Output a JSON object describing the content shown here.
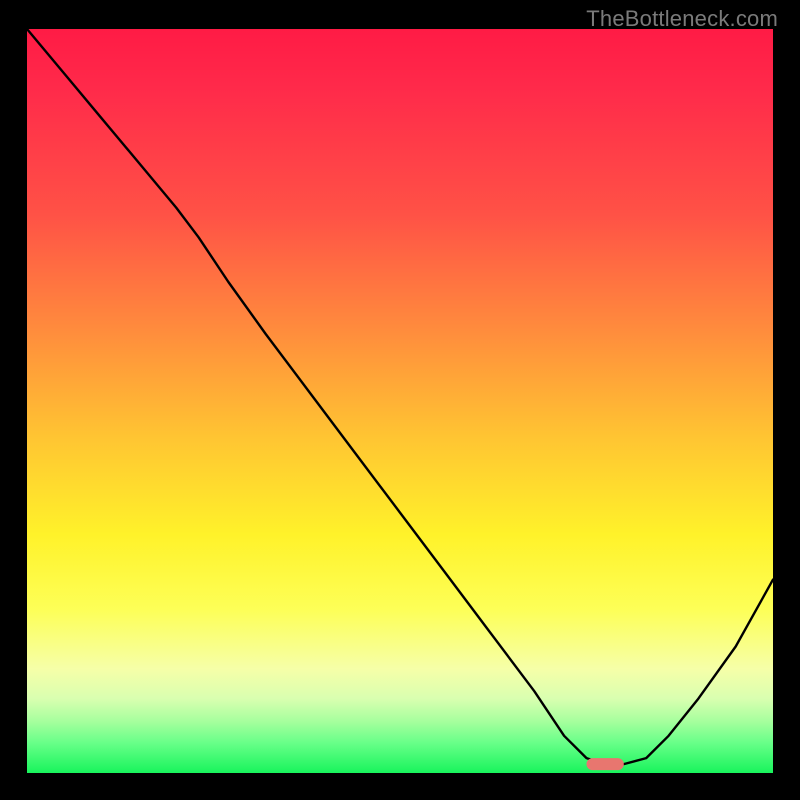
{
  "watermark": "TheBottleneck.com",
  "colors": {
    "frame": "#000000",
    "curve": "#000000",
    "marker": "#e8766f",
    "gradient_stops": [
      "#ff1b45",
      "#ff2a4a",
      "#ff5246",
      "#ff8a3d",
      "#ffc532",
      "#fff22a",
      "#fdff57",
      "#f6ffa8",
      "#d9ffb0",
      "#a7ff9e",
      "#67ff88",
      "#18f45c"
    ]
  },
  "chart_data": {
    "type": "line",
    "title": "",
    "xlabel": "",
    "ylabel": "",
    "xlim": [
      0,
      100
    ],
    "ylim": [
      0,
      100
    ],
    "grid": false,
    "legend": false,
    "series": [
      {
        "name": "bottleneck-curve",
        "x": [
          0,
          5,
          10,
          15,
          20,
          23,
          27,
          32,
          38,
          44,
          50,
          56,
          62,
          68,
          72,
          75,
          78,
          80,
          83,
          86,
          90,
          95,
          100
        ],
        "y": [
          100,
          94,
          88,
          82,
          76,
          72,
          66,
          59,
          51,
          43,
          35,
          27,
          19,
          11,
          5,
          2,
          1,
          1.2,
          2,
          5,
          10,
          17,
          26
        ]
      }
    ],
    "annotations": [
      {
        "name": "optimal-marker",
        "shape": "rounded-bar",
        "x_range": [
          75,
          80
        ],
        "y": 1.2
      }
    ]
  }
}
